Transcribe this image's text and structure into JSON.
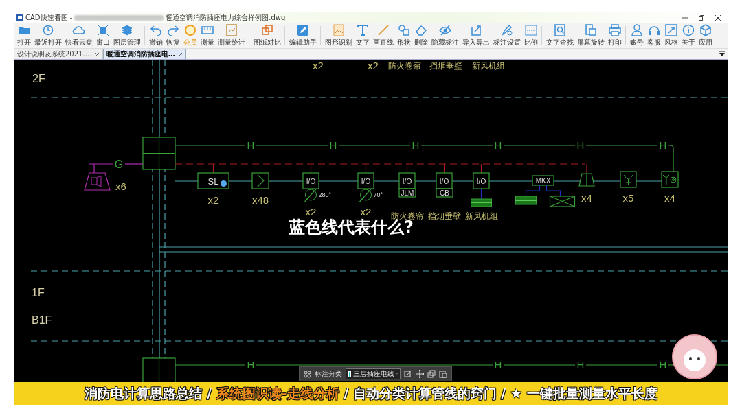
{
  "window": {
    "title_app": "CAD快速看图 - ",
    "title_file": "暖通空调消防插座电力综合样例图.dwg"
  },
  "toolbar": {
    "groups": [
      [
        {
          "label": "打开",
          "highlight": false
        },
        {
          "label": "最近打开",
          "highlight": false
        },
        {
          "label": "快看云盘",
          "highlight": false
        },
        {
          "label": "窗口",
          "highlight": false
        },
        {
          "label": "图层管理",
          "highlight": false
        }
      ],
      [
        {
          "label": "撤销",
          "highlight": false
        },
        {
          "label": "恢复",
          "highlight": false
        },
        {
          "label": "会员",
          "highlight": true
        },
        {
          "label": "测量",
          "highlight": false
        },
        {
          "label": "测量统计",
          "highlight": false
        }
      ],
      [
        {
          "label": "图纸对比",
          "highlight": false
        }
      ],
      [
        {
          "label": "编辑助手",
          "highlight": false
        }
      ],
      [
        {
          "label": "图形识别",
          "highlight": false
        },
        {
          "label": "文字",
          "highlight": false
        },
        {
          "label": "画直线",
          "highlight": false
        },
        {
          "label": "形状",
          "highlight": false
        },
        {
          "label": "删除",
          "highlight": false
        },
        {
          "label": "隐藏标注",
          "highlight": false
        },
        {
          "label": "导入导出",
          "highlight": false
        },
        {
          "label": "标注设置",
          "highlight": false
        },
        {
          "label": "比例",
          "highlight": false
        }
      ],
      [
        {
          "label": "文字查找",
          "highlight": false
        },
        {
          "label": "屏幕旋转",
          "highlight": false
        },
        {
          "label": "打印",
          "highlight": false
        }
      ],
      [
        {
          "label": "账号",
          "highlight": false
        },
        {
          "label": "客服",
          "highlight": false
        },
        {
          "label": "风格",
          "highlight": false
        },
        {
          "label": "关于",
          "highlight": false
        },
        {
          "label": "应用",
          "highlight": false
        }
      ]
    ]
  },
  "tabs": [
    {
      "label": "设计说明及系统2021.…",
      "selected": false
    },
    {
      "label": "暖通空调消防插座电…",
      "selected": true
    }
  ],
  "drawing": {
    "floor_labels": [
      "2F",
      "1F",
      "B1F"
    ],
    "top_labels": [
      "x2",
      "x2",
      "防火卷帘",
      "挡烟垂壁",
      "新风机组"
    ],
    "source": {
      "label": "G",
      "count": "x6"
    },
    "h_labels": [
      "H",
      "H",
      "H",
      "H",
      "H",
      "H"
    ],
    "bottom_h_labels": [
      "H",
      "H",
      "H",
      "H"
    ],
    "devices": [
      {
        "kind": "box",
        "label": "SL",
        "count": "x2"
      },
      {
        "kind": "damper",
        "count": "x48"
      },
      {
        "kind": "io",
        "label": "I/O",
        "angle": "280°",
        "count": "x2"
      },
      {
        "kind": "io",
        "label": "I/O",
        "angle": "70°",
        "count": "x2"
      },
      {
        "kind": "io",
        "label": "I/O",
        "tag": "JLM",
        "name": "防火卷帘"
      },
      {
        "kind": "io",
        "label": "I/O",
        "tag": "CB",
        "name": "挡烟垂壁"
      },
      {
        "kind": "io_unit",
        "label": "I/O",
        "name": "新风机组"
      },
      {
        "kind": "mkx",
        "label": "MKX"
      },
      {
        "kind": "valve",
        "count": "x4"
      },
      {
        "kind": "fork",
        "count": "x5"
      },
      {
        "kind": "fork_ring",
        "count": "x4"
      }
    ]
  },
  "question": "蓝色线代表什么?",
  "float_toolbar": {
    "label": "标注分类",
    "layer": "三层插座电线"
  },
  "caption": [
    {
      "text": "消防电计算思路总结 / ",
      "highlight": false
    },
    {
      "text": "系统图识读-走线分析",
      "highlight": true
    },
    {
      "text": " / 自动分类计算管线的窍门 / ★ 一键批量测量水平长度",
      "highlight": false
    }
  ]
}
